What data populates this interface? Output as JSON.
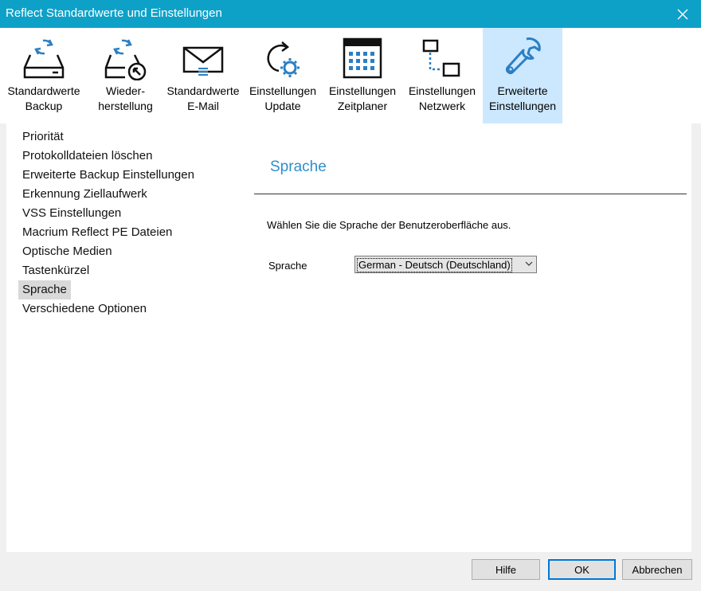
{
  "window": {
    "title": "Reflect Standardwerte und Einstellungen"
  },
  "toolbar": {
    "items": [
      {
        "line1": "Standardwerte",
        "line2": "Backup",
        "icon": "drive-backup-icon"
      },
      {
        "line1": "Wieder-",
        "line2": "herstellung",
        "icon": "drive-restore-icon"
      },
      {
        "line1": "Standardwerte",
        "line2": "E-Mail",
        "icon": "envelope-icon"
      },
      {
        "line1": "Einstellungen",
        "line2": "Update",
        "icon": "update-gear-icon"
      },
      {
        "line1": "Einstellungen",
        "line2": "Zeitplaner",
        "icon": "calendar-icon"
      },
      {
        "line1": "Einstellungen",
        "line2": "Netzwerk",
        "icon": "network-icon"
      },
      {
        "line1": "Erweiterte",
        "line2": "Einstellungen",
        "icon": "wrench-icon",
        "selected": true
      }
    ]
  },
  "sidebar": {
    "items": [
      "Priorität",
      "Protokolldateien löschen",
      "Erweiterte Backup Einstellungen",
      "Erkennung Ziellaufwerk",
      "VSS Einstellungen",
      "Macrium Reflect PE Dateien",
      "Optische Medien",
      "Tastenkürzel",
      "Sprache",
      "Verschiedene Optionen"
    ],
    "selected": "Sprache"
  },
  "panel": {
    "title": "Sprache",
    "description": "Wählen Sie die Sprache der Benutzeroberfläche aus.",
    "language_label": "Sprache",
    "language_value": "German - Deutsch (Deutschland)"
  },
  "buttons": {
    "help": "Hilfe",
    "ok": "OK",
    "cancel": "Abbrechen"
  },
  "colors": {
    "titlebar": "#0ea1c8",
    "selected_tab": "#cce8ff",
    "section_title": "#2e8fc9",
    "icon_accent": "#2a7fc4"
  }
}
